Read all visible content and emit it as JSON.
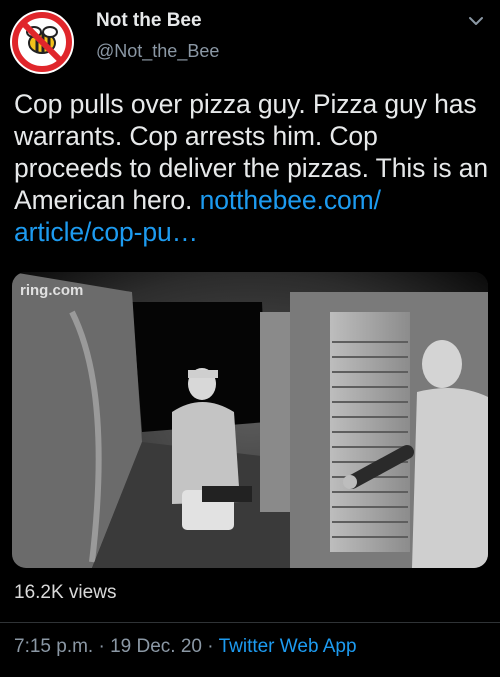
{
  "tweet": {
    "display_name": "Not the Bee",
    "handle": "@Not_the_Bee",
    "text_plain": "Cop pulls over pizza guy. Pizza guy has warrants. Cop arrests him. Cop proceeds to deliver the pizzas. This is an American hero.",
    "link_line1": "notthebee.com/",
    "link_line2": "article/cop-pu…",
    "views": "16.2K views",
    "time": "7:15 p.m.",
    "separator": "·",
    "date": "19 Dec. 20",
    "source_app": "Twitter Web App"
  },
  "media": {
    "watermark": "ring.com"
  },
  "icons": {
    "avatar": "not-the-bee-logo-icon",
    "menu": "chevron-down-icon"
  },
  "colors": {
    "background": "#000000",
    "text": "#e7e9ea",
    "muted": "#8b98a5",
    "link": "#1d9bf0"
  }
}
